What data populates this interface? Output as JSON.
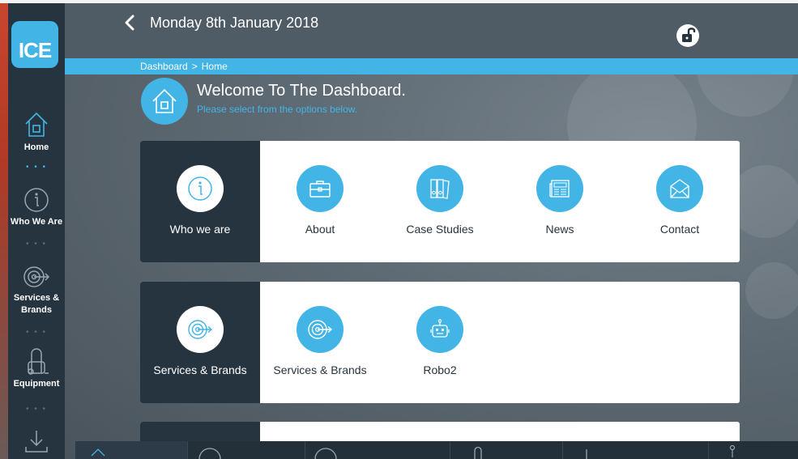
{
  "app": {
    "logo_text": "ICE"
  },
  "header": {
    "date": "Monday 8th January 2018"
  },
  "breadcrumb": {
    "items": [
      "Dashboard",
      "Home"
    ],
    "separator": ">"
  },
  "welcome": {
    "title": "Welcome To The Dashboard.",
    "subtitle": "Please select from the options below."
  },
  "sidebar": {
    "items": [
      {
        "label": "Home",
        "icon": "home-icon",
        "active": true
      },
      {
        "label": "Who We Are",
        "icon": "info-icon"
      },
      {
        "label": "Services & Brands",
        "icon": "target-icon"
      },
      {
        "label": "Equipment",
        "icon": "vacuum-icon"
      },
      {
        "label": "",
        "icon": "download-icon"
      }
    ]
  },
  "cards": [
    {
      "lead_label": "Who we are",
      "lead_icon": "info-icon",
      "options": [
        {
          "label": "About",
          "icon": "briefcase-icon"
        },
        {
          "label": "Case Studies",
          "icon": "binders-icon"
        },
        {
          "label": "News",
          "icon": "newspaper-icon"
        },
        {
          "label": "Contact",
          "icon": "envelope-icon"
        }
      ]
    },
    {
      "lead_label": "Services & Brands",
      "lead_icon": "target-icon",
      "options": [
        {
          "label": "Services & Brands",
          "icon": "target-icon"
        },
        {
          "label": "Robo2",
          "icon": "robot-icon"
        }
      ]
    }
  ],
  "colors": {
    "accent": "#42b4e6",
    "dark": "#263440",
    "header": "#4f5b65"
  }
}
